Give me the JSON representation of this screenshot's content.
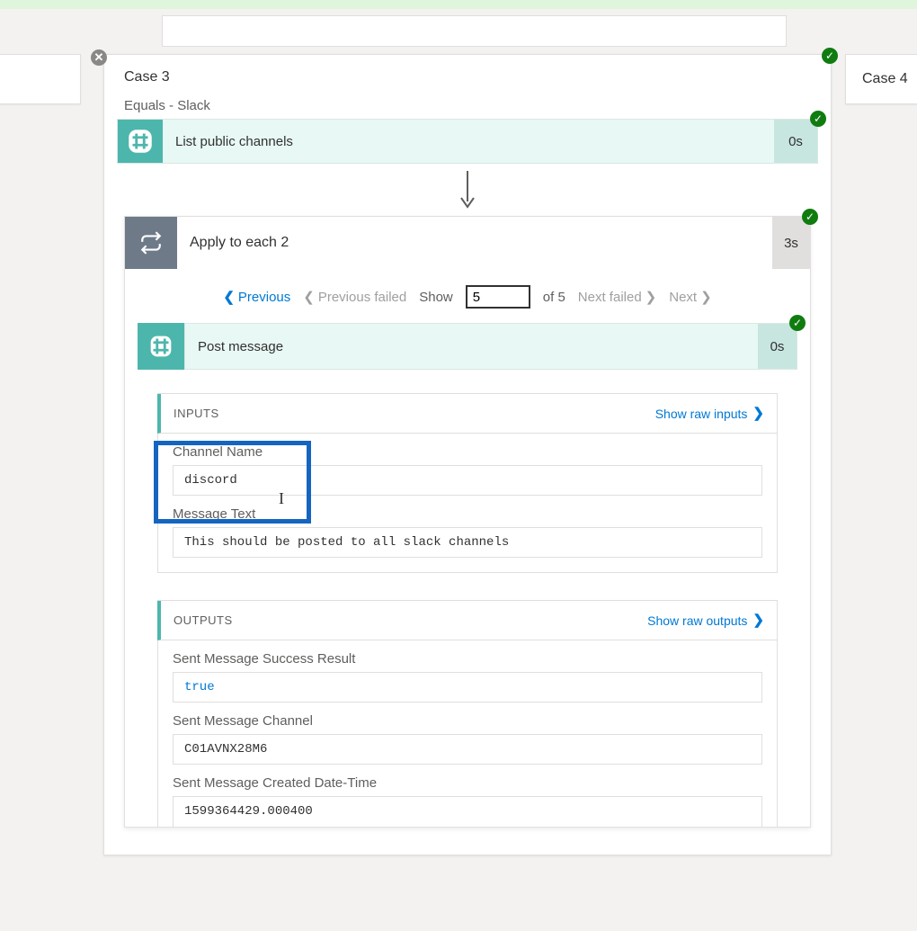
{
  "cases": {
    "left_title": "",
    "right_title": "Case 4",
    "main_title": "Case 3"
  },
  "sub": "Equals - Slack",
  "step1": {
    "label": "List public channels",
    "duration": "0s"
  },
  "loop": {
    "title": "Apply to each 2",
    "duration": "3s"
  },
  "pager": {
    "prev": "Previous",
    "prev_failed": "Previous failed",
    "show_label": "Show",
    "current": "5",
    "of_label": "of 5",
    "next_failed": "Next failed",
    "next": "Next"
  },
  "inner": {
    "label": "Post message",
    "duration": "0s"
  },
  "inputs": {
    "header": "INPUTS",
    "raw_link": "Show raw inputs",
    "fields": {
      "channel_name_label": "Channel Name",
      "channel_name_value": "discord",
      "message_text_label": "Message Text",
      "message_text_value": "This should be posted to all slack channels"
    }
  },
  "outputs": {
    "header": "OUTPUTS",
    "raw_link": "Show raw outputs",
    "fields": {
      "success_label": "Sent Message Success Result",
      "success_value": "true",
      "channel_label": "Sent Message Channel",
      "channel_value": "C01AVNX28M6",
      "created_label": "Sent Message Created Date-Time",
      "created_value": "1599364429.000400"
    }
  }
}
